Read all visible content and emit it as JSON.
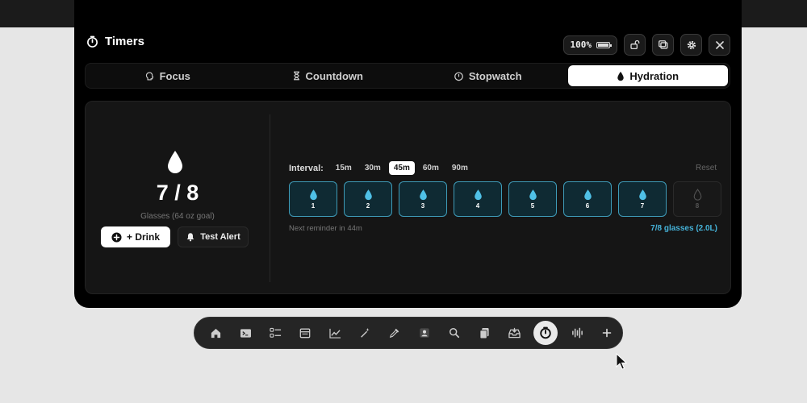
{
  "window": {
    "title": "Timers",
    "battery_label": "100%"
  },
  "tabs": [
    {
      "label": "Focus",
      "icon": "brain-icon"
    },
    {
      "label": "Countdown",
      "icon": "hourglass-icon"
    },
    {
      "label": "Stopwatch",
      "icon": "stopwatch-icon"
    },
    {
      "label": "Hydration",
      "icon": "water-drop-icon",
      "active": true
    }
  ],
  "hydration": {
    "count_label": "7 / 8",
    "goal_label": "Glasses (64 oz goal)",
    "drink_label": "+ Drink",
    "test_alert_label": "Test Alert",
    "interval_label": "Interval:",
    "interval_options": [
      "15m",
      "30m",
      "45m",
      "60m",
      "90m"
    ],
    "interval_selected": "45m",
    "reset_label": "Reset",
    "glasses": [
      {
        "num": "1",
        "filled": true
      },
      {
        "num": "2",
        "filled": true
      },
      {
        "num": "3",
        "filled": true
      },
      {
        "num": "4",
        "filled": true
      },
      {
        "num": "5",
        "filled": true
      },
      {
        "num": "6",
        "filled": true
      },
      {
        "num": "7",
        "filled": true
      },
      {
        "num": "8",
        "filled": false
      }
    ],
    "reminder_text": "Next reminder in 44m",
    "summary_text": "7/8 glasses (2.0L)"
  },
  "dock": {
    "items": [
      "home-icon",
      "terminal-icon",
      "checklist-icon",
      "calendar-icon",
      "chart-icon",
      "magic-wand-icon",
      "eyedropper-icon",
      "contact-icon",
      "search-icon",
      "clipboard-icon",
      "inbox-icon",
      "timer-icon",
      "audio-wave-icon",
      "plus-icon"
    ],
    "active": "timer-icon"
  },
  "colors": {
    "accent": "#45b2d8",
    "glass_border": "#3e9bb8",
    "window_bg": "#000000",
    "panel_bg": "#151515"
  }
}
